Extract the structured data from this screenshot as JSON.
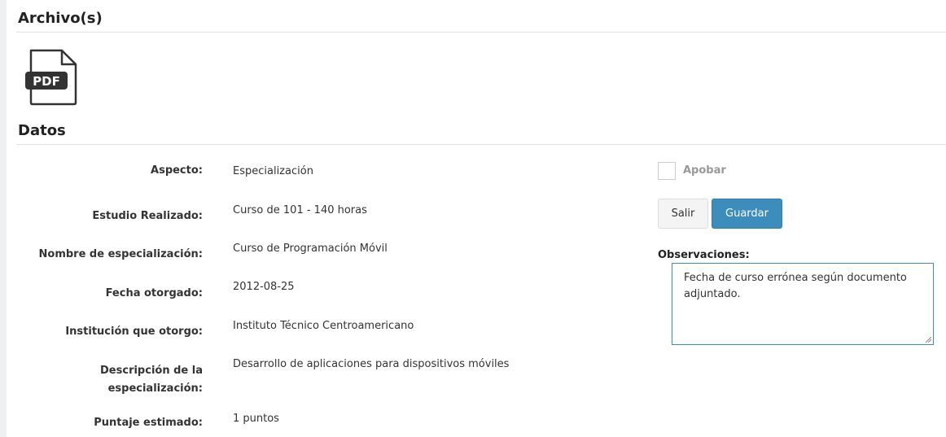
{
  "archivos": {
    "title": "Archivo(s)",
    "file_icon": "pdf-file-icon",
    "file_icon_text": "PDF"
  },
  "datos": {
    "title": "Datos",
    "fields": [
      {
        "label": "Aspecto:",
        "value": "Especialización"
      },
      {
        "label": "Estudio Realizado:",
        "value": "Curso de 101 - 140 horas"
      },
      {
        "label": "Nombre de especialización:",
        "value": "Curso de Programación Móvil"
      },
      {
        "label": "Fecha otorgado:",
        "value": "2012-08-25"
      },
      {
        "label": "Institución que otorgo:",
        "value": "Instituto Técnico Centroamericano"
      },
      {
        "label_line1": "Descripción de la",
        "label_line2": "especialización:",
        "value": "Desarrollo de aplicaciones para dispositivos móviles"
      },
      {
        "label": "Puntaje estimado:",
        "value": "1 puntos"
      }
    ]
  },
  "actions": {
    "approve_label": "Apobar",
    "approve_checked": false,
    "exit_label": "Salir",
    "save_label": "Guardar",
    "save_color": "#3c8dbc"
  },
  "observaciones": {
    "label": "Observaciones:",
    "value": "Fecha de curso errónea según documento adjuntado."
  }
}
